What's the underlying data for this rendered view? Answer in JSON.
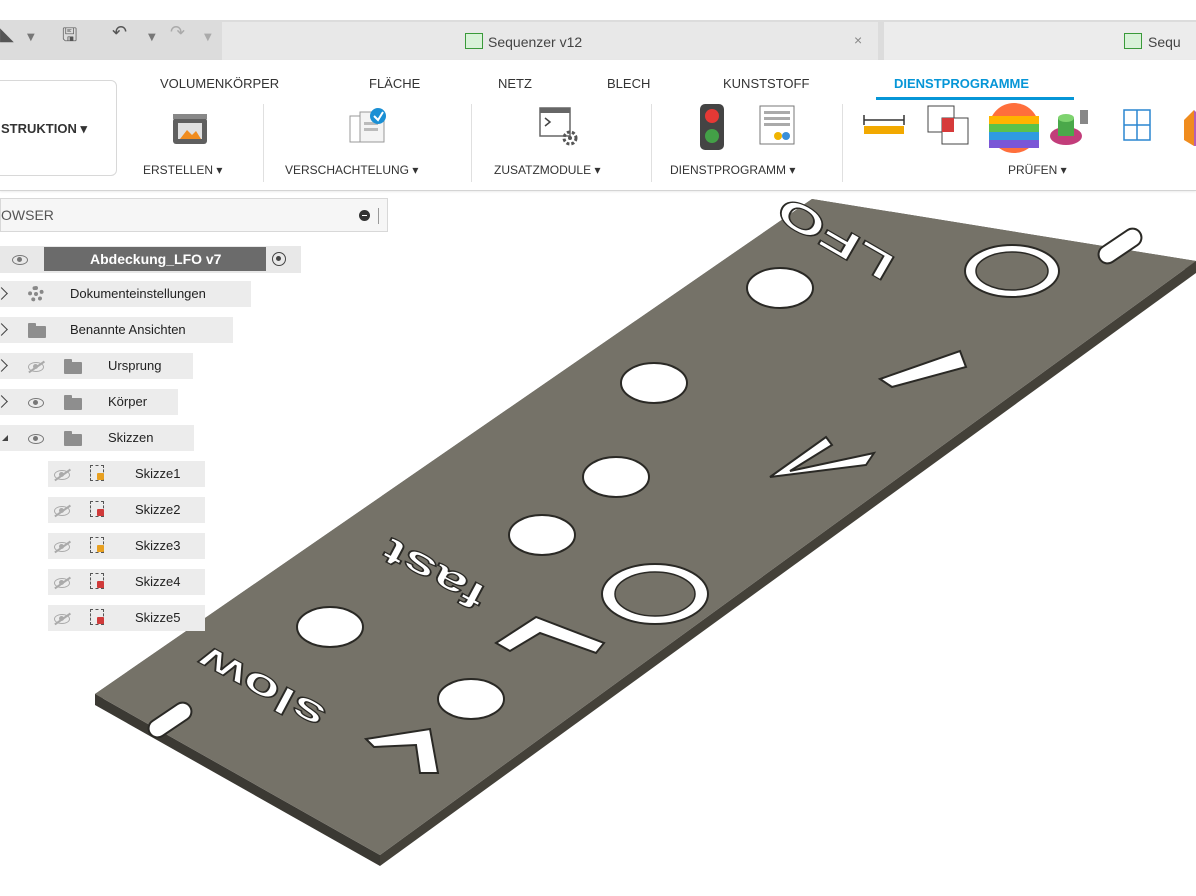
{
  "titlebar": {
    "tab_active_title": "Sequenzer v12",
    "tab_close": "×",
    "tab_second_title": "Sequ"
  },
  "ribbon": {
    "tabs": [
      {
        "label": "VOLUMENKÖRPER"
      },
      {
        "label": "FLÄCHE"
      },
      {
        "label": "NETZ"
      },
      {
        "label": "BLECH"
      },
      {
        "label": "KUNSTSTOFF"
      },
      {
        "label": "DIENSTPROGRAMME",
        "active": true
      }
    ],
    "construct_label": "STRUKTION ▾",
    "groups": [
      {
        "label": "ERSTELLEN ▾"
      },
      {
        "label": "VERSCHACHTELUNG ▾"
      },
      {
        "label": "ZUSATZMODULE ▾"
      },
      {
        "label": "DIENSTPROGRAMM ▾"
      },
      {
        "label": "PRÜFEN ▾"
      }
    ],
    "accent_color": "#0696d7"
  },
  "browser": {
    "title": "OWSER",
    "root": {
      "label": "Abdeckung_LFO v7"
    },
    "items": [
      {
        "label": "Dokumenteinstellungen"
      },
      {
        "label": "Benannte Ansichten"
      },
      {
        "label": "Ursprung"
      },
      {
        "label": "Körper"
      },
      {
        "label": "Skizzen"
      }
    ],
    "sketches": [
      {
        "label": "Skizze1"
      },
      {
        "label": "Skizze2"
      },
      {
        "label": "Skizze3"
      },
      {
        "label": "Skizze4"
      },
      {
        "label": "Skizze5"
      }
    ]
  },
  "model": {
    "engraved_texts": [
      {
        "text": "LFO"
      },
      {
        "text": "fast"
      },
      {
        "text": "slow"
      }
    ],
    "plate_color": "#757268"
  }
}
